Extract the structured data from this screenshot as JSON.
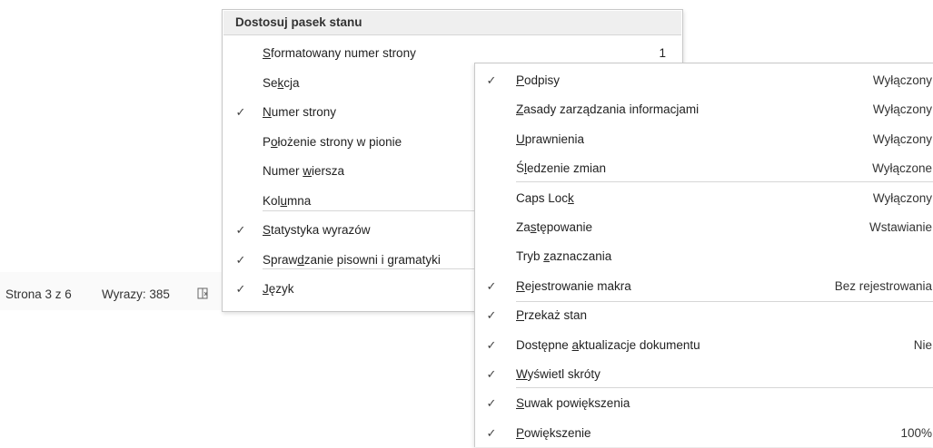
{
  "statusbar": {
    "page": "Strona 3 z 6",
    "words": "Wyrazy: 385",
    "proofing_icon": "proofing-book-icon"
  },
  "menu1": {
    "title": "Dostosuj pasek stanu",
    "items": [
      {
        "checked": false,
        "pre": "",
        "u": "S",
        "post": "formatowany numer strony",
        "value": "1"
      },
      {
        "checked": false,
        "pre": "Se",
        "u": "k",
        "post": "cja",
        "value": ""
      },
      {
        "checked": true,
        "pre": "",
        "u": "N",
        "post": "umer strony",
        "value": ""
      },
      {
        "checked": false,
        "pre": "P",
        "u": "o",
        "post": "łożenie strony w pionie",
        "value": ""
      },
      {
        "checked": false,
        "pre": "Numer ",
        "u": "w",
        "post": "iersza",
        "value": ""
      },
      {
        "checked": false,
        "pre": "Kol",
        "u": "u",
        "post": "mna",
        "value": ""
      },
      {
        "checked": true,
        "pre": "",
        "u": "S",
        "post": "tatystyka wyrazów",
        "value": ""
      },
      {
        "checked": true,
        "pre": "Spraw",
        "u": "d",
        "post": "zanie pisowni i gramatyki",
        "value": ""
      },
      {
        "checked": true,
        "pre": "",
        "u": "J",
        "post": "ęzyk",
        "value": ""
      }
    ]
  },
  "menu2": {
    "items": [
      {
        "checked": true,
        "pre": "",
        "u": "P",
        "post": "odpisy",
        "value": "Wyłączony"
      },
      {
        "checked": false,
        "pre": "",
        "u": "Z",
        "post": "asady zarządzania informacjami",
        "value": "Wyłączony"
      },
      {
        "checked": false,
        "pre": "",
        "u": "U",
        "post": "prawnienia",
        "value": "Wyłączony"
      },
      {
        "checked": false,
        "pre": "Ś",
        "u": "l",
        "post": "edzenie zmian",
        "value": "Wyłączone"
      },
      {
        "checked": false,
        "pre": "Caps Loc",
        "u": "k",
        "post": "",
        "value": "Wyłączony"
      },
      {
        "checked": false,
        "pre": "Za",
        "u": "s",
        "post": "tępowanie",
        "value": "Wstawianie"
      },
      {
        "checked": false,
        "pre": "Tryb ",
        "u": "z",
        "post": "aznaczania",
        "value": ""
      },
      {
        "checked": true,
        "pre": "",
        "u": "R",
        "post": "ejestrowanie makra",
        "value": "Bez rejestrowania"
      },
      {
        "checked": true,
        "pre": "",
        "u": "P",
        "post": "rzekaż stan",
        "value": ""
      },
      {
        "checked": true,
        "pre": "Dostępne ",
        "u": "a",
        "post": "ktualizacje dokumentu",
        "value": "Nie"
      },
      {
        "checked": true,
        "pre": "",
        "u": "W",
        "post": "yświetl skróty",
        "value": ""
      },
      {
        "checked": true,
        "pre": "",
        "u": "S",
        "post": "uwak powiększenia",
        "value": ""
      },
      {
        "checked": true,
        "pre": "",
        "u": "P",
        "post": "owiększenie",
        "value": "100%"
      }
    ]
  },
  "check_glyph": "✓"
}
